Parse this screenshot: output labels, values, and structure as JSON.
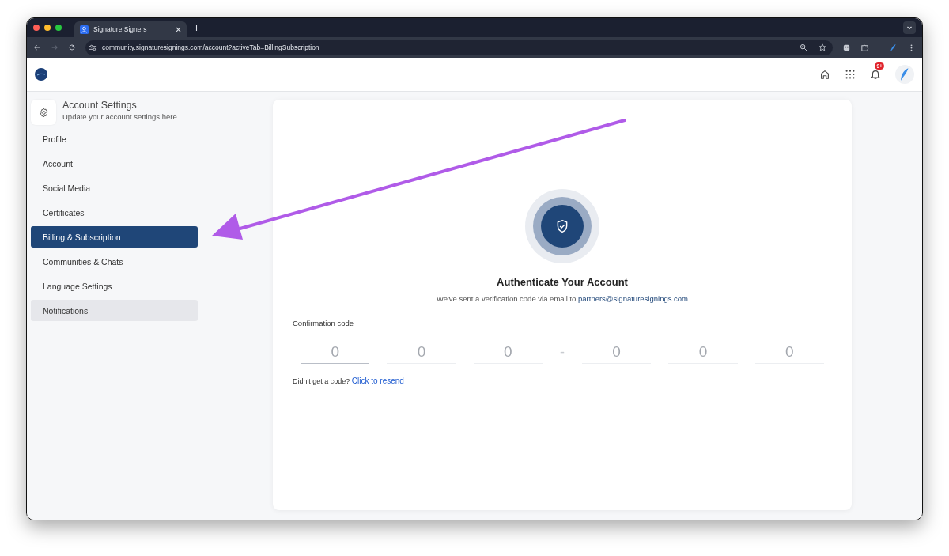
{
  "browser": {
    "tab": {
      "title": "Signature Signers"
    },
    "url": "community.signaturesignings.com/account?activeTab=BillingSubscription"
  },
  "header": {
    "notification_badge": "9+"
  },
  "sidebar": {
    "title": "Account Settings",
    "subtitle": "Update your account settings here",
    "items": [
      {
        "label": "Profile",
        "selected": false,
        "highlighted": false
      },
      {
        "label": "Account",
        "selected": false,
        "highlighted": false
      },
      {
        "label": "Social Media",
        "selected": false,
        "highlighted": false
      },
      {
        "label": "Certificates",
        "selected": false,
        "highlighted": false
      },
      {
        "label": "Billing & Subscription",
        "selected": true,
        "highlighted": false
      },
      {
        "label": "Communities & Chats",
        "selected": false,
        "highlighted": false
      },
      {
        "label": "Language Settings",
        "selected": false,
        "highlighted": false
      },
      {
        "label": "Notifications",
        "selected": false,
        "highlighted": true
      }
    ]
  },
  "verification": {
    "title": "Authenticate Your Account",
    "message": "We've sent a verification code via email to",
    "email": "partners@signaturesignings.com",
    "code_label": "Confirmation code",
    "code_groups": [
      [
        {
          "placeholder": "0",
          "focused": true
        },
        {
          "placeholder": "0",
          "focused": false
        },
        {
          "placeholder": "0",
          "focused": false
        }
      ],
      [
        {
          "placeholder": "0",
          "focused": false
        },
        {
          "placeholder": "0",
          "focused": false
        },
        {
          "placeholder": "0",
          "focused": false
        }
      ]
    ],
    "separator": "-",
    "resend_prompt": "Didn't get a code?",
    "resend_link": "Click to resend"
  }
}
